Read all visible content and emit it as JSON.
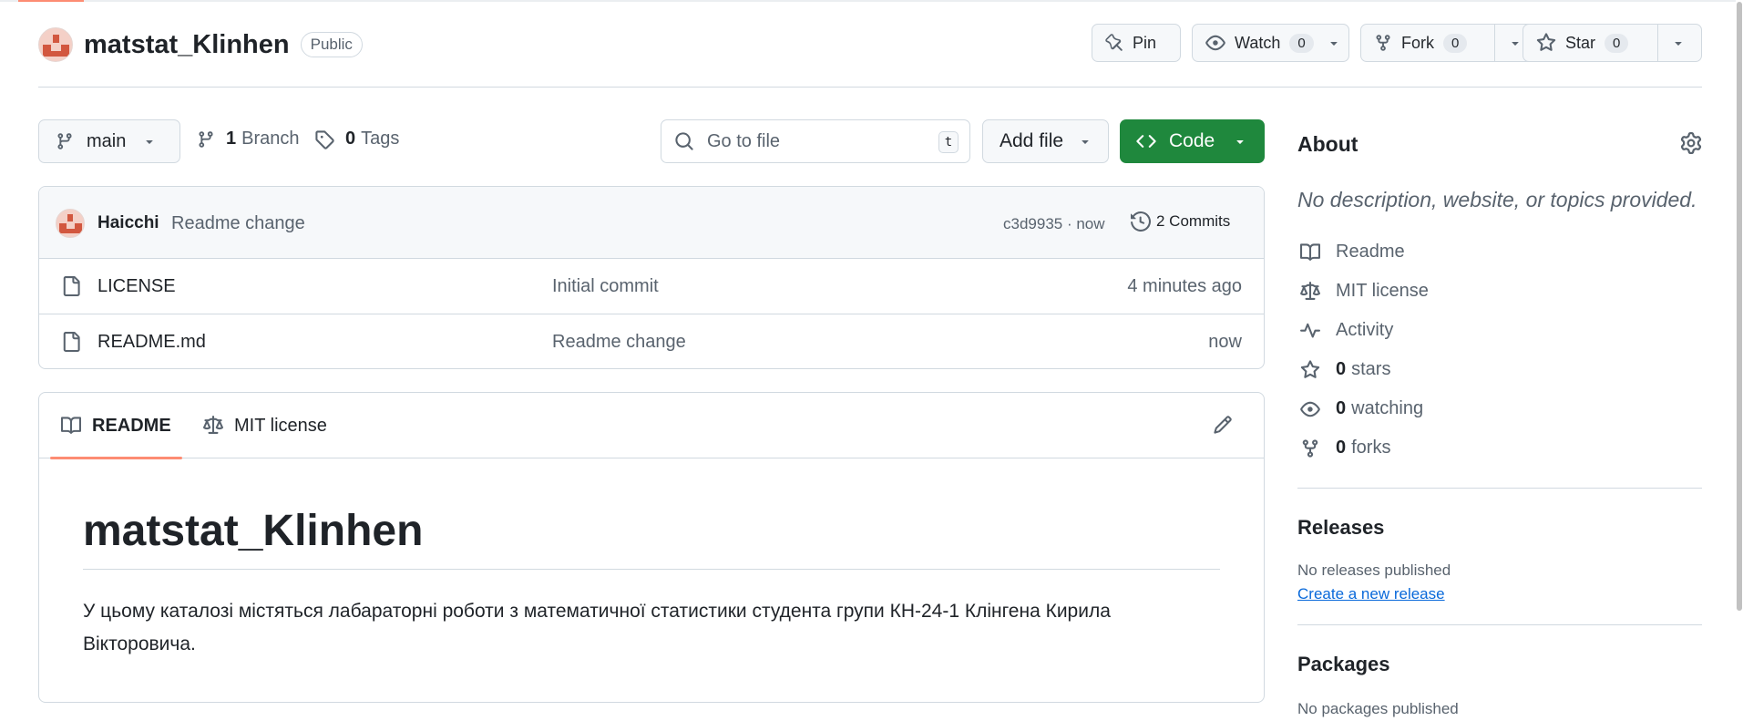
{
  "repo": {
    "name": "matstat_Klinhen",
    "visibility": "Public"
  },
  "header_actions": {
    "pin": "Pin",
    "watch": "Watch",
    "watch_count": "0",
    "fork": "Fork",
    "fork_count": "0",
    "star": "Star",
    "star_count": "0"
  },
  "toolbar": {
    "branch": "main",
    "branch_count": "1",
    "branch_label": "Branch",
    "tag_count": "0",
    "tag_label": "Tags",
    "goto_placeholder": "Go to file",
    "goto_shortcut": "t",
    "add_file": "Add file",
    "code": "Code"
  },
  "latest_commit": {
    "author": "Haicchi",
    "message": "Readme change",
    "hash_time": "c3d9935 · now",
    "commits": "2 Commits"
  },
  "files": [
    {
      "name": "LICENSE",
      "message": "Initial commit",
      "time": "4 minutes ago"
    },
    {
      "name": "README.md",
      "message": "Readme change",
      "time": "now"
    }
  ],
  "readme": {
    "tab_readme": "README",
    "tab_license": "MIT license",
    "title": "matstat_Klinhen",
    "text": "У цьому каталозі містяться лабараторні роботи з математичної статистики студента групи КН-24-1 Клінгена Кирила Вікторовича."
  },
  "sidebar": {
    "about_title": "About",
    "description": "No description, website, or topics provided.",
    "items": {
      "readme": "Readme",
      "license": "MIT license",
      "activity": "Activity",
      "stars_count": "0",
      "stars_label": "stars",
      "watching_count": "0",
      "watching_label": "watching",
      "forks_count": "0",
      "forks_label": "forks"
    },
    "releases_title": "Releases",
    "releases_empty": "No releases published",
    "create_release": "Create a new release",
    "packages_title": "Packages",
    "packages_empty": "No packages published"
  },
  "colors": {
    "primary_button": "#1f883d",
    "accent_underline": "#fd8c73",
    "link": "#0969da"
  }
}
